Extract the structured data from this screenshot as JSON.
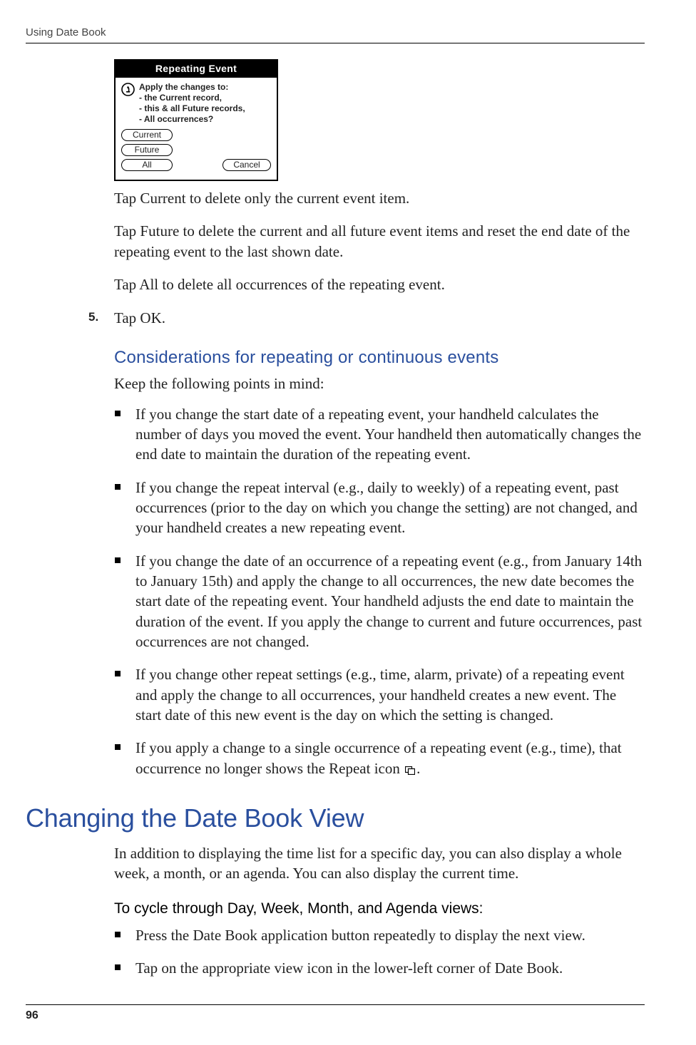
{
  "running_head": "Using Date Book",
  "page_number": "96",
  "dialog": {
    "title": "Repeating Event",
    "prompt": "Apply the changes to:",
    "options": [
      "- the Current record,",
      "- this & all Future records,",
      "- All occurrences?"
    ],
    "btn_current": "Current",
    "btn_future": "Future",
    "btn_all": "All",
    "btn_cancel": "Cancel"
  },
  "tap_current": "Tap Current to delete only the current event item.",
  "tap_future": "Tap Future to delete the current and all future event items and reset the end date of the repeating event to the last shown date.",
  "tap_all": "Tap All to delete all occurrences of the repeating event.",
  "step5_num": "5.",
  "step5_text": "Tap OK.",
  "considerations_heading": "Considerations for repeating or continuous events",
  "considerations_intro": "Keep the following points in mind:",
  "consider": {
    "b1": "If you change the start date of a repeating event, your handheld calculates the number of days you moved the event. Your handheld then automatically changes the end date to maintain the duration of the repeating event.",
    "b2": "If you change the repeat interval (e.g., daily to weekly) of a repeating event, past occurrences (prior to the day on which you change the setting) are not changed, and your handheld creates a new repeating event.",
    "b3": "If you change the date of an occurrence of a repeating event (e.g., from January 14th to January 15th) and apply the change to all occurrences, the new date becomes the start date of the repeating event. Your handheld adjusts the end date to maintain the duration of the event. If you apply the change to current and future occurrences, past occurrences are not changed.",
    "b4": "If you change other repeat settings (e.g., time, alarm, private) of a repeating event and apply the change to all occurrences, your handheld creates a new event. The start date of this new event is the day on which the setting is changed.",
    "b5_a": "If you apply a change to a single occurrence of a repeating event (e.g., time), that occurrence no longer shows the Repeat icon ",
    "b5_b": "."
  },
  "changing_heading": "Changing the Date Book View",
  "changing_intro": "In addition to displaying the time list for a specific day, you can also display a whole week, a month, or an agenda. You can also display the current time.",
  "cycle_heading": "To cycle through Day, Week, Month, and Agenda views:",
  "cycle": {
    "b1": "Press the Date Book application button repeatedly to display the next view.",
    "b2": "Tap on the appropriate view icon in the lower-left corner of Date Book."
  }
}
